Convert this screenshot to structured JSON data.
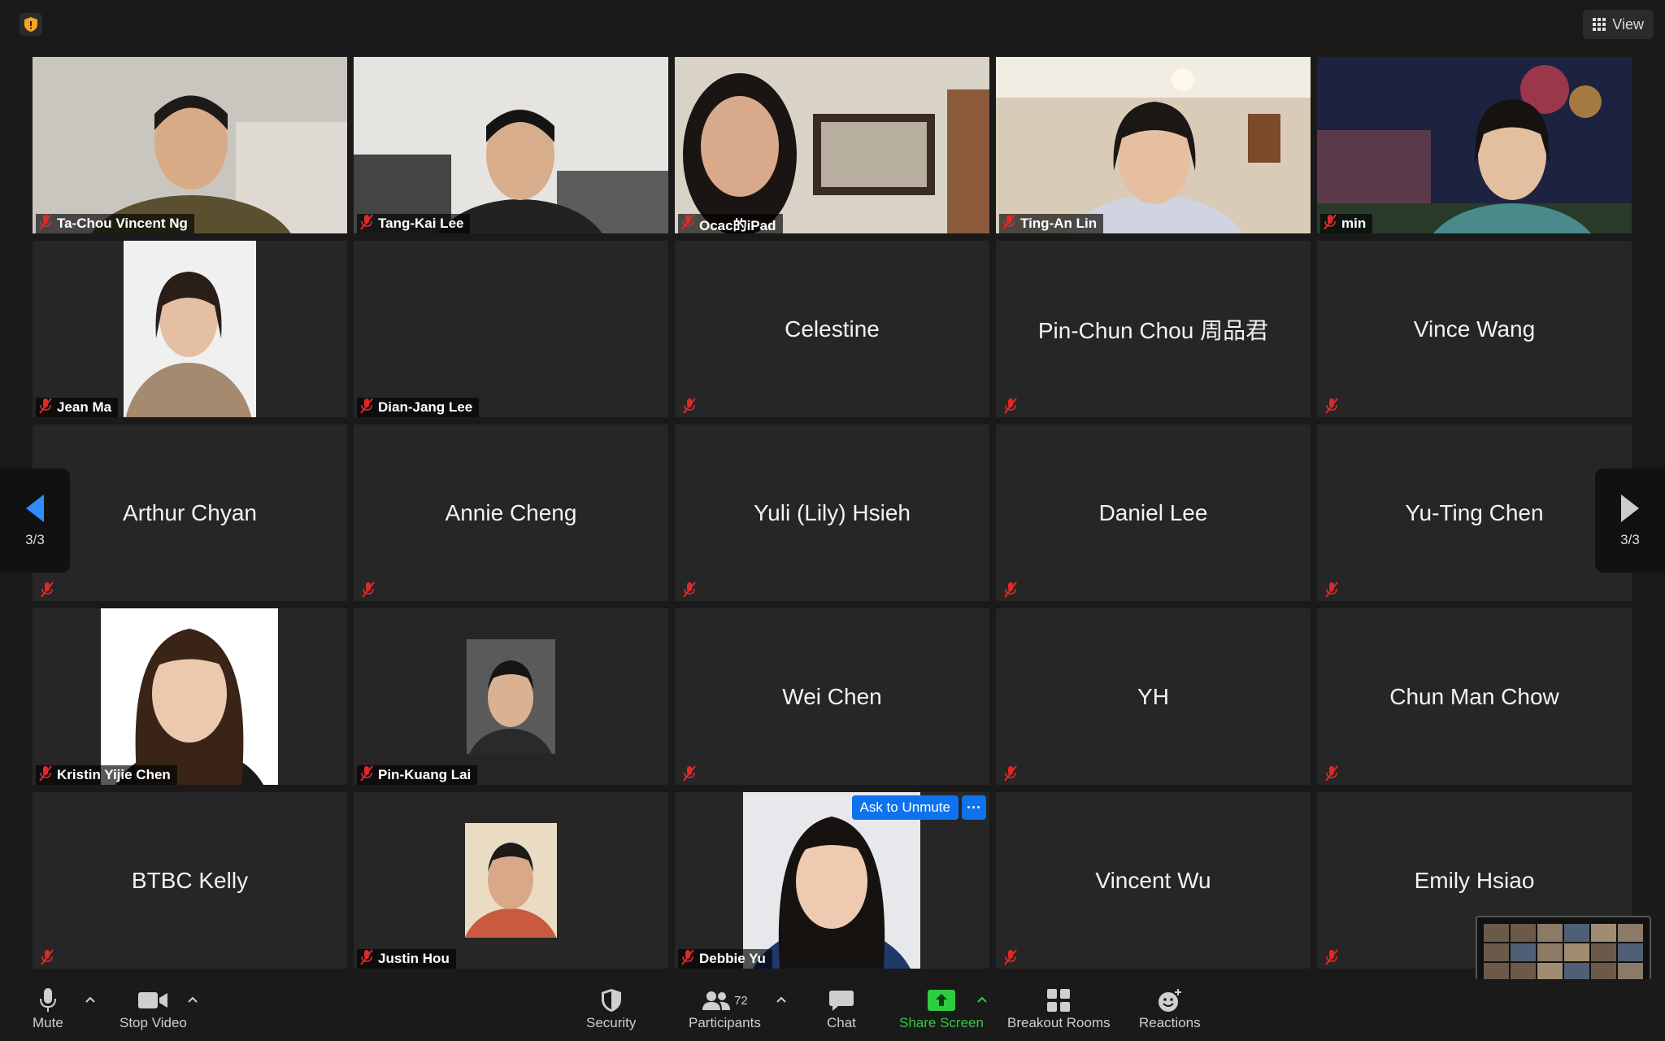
{
  "topbar": {
    "view_label": "View"
  },
  "pagination": {
    "left_label": "3/3",
    "right_label": "3/3"
  },
  "tiles": [
    {
      "name": "Ta-Chou Vincent Ng",
      "mode": "video"
    },
    {
      "name": "Tang-Kai Lee",
      "mode": "video"
    },
    {
      "name": "Ocac的iPad",
      "mode": "video"
    },
    {
      "name": "Ting-An Lin",
      "mode": "video"
    },
    {
      "name": "min",
      "mode": "video"
    },
    {
      "name": "Jean Ma",
      "mode": "photo"
    },
    {
      "name": "Dian-Jang Lee",
      "mode": "blank"
    },
    {
      "name": "Celestine",
      "mode": "name"
    },
    {
      "name": "Pin-Chun Chou 周品君",
      "mode": "name"
    },
    {
      "name": "Vince Wang",
      "mode": "name"
    },
    {
      "name": "Arthur Chyan",
      "mode": "name"
    },
    {
      "name": "Annie Cheng",
      "mode": "name"
    },
    {
      "name": "Yuli (Lily) Hsieh",
      "mode": "name"
    },
    {
      "name": "Daniel Lee",
      "mode": "name"
    },
    {
      "name": "Yu-Ting Chen",
      "mode": "name"
    },
    {
      "name": "Kristin Yijie Chen",
      "mode": "photo"
    },
    {
      "name": "Pin-Kuang Lai",
      "mode": "photo"
    },
    {
      "name": "Wei Chen",
      "mode": "name"
    },
    {
      "name": "YH",
      "mode": "name"
    },
    {
      "name": "Chun Man Chow",
      "mode": "name"
    },
    {
      "name": "BTBC Kelly",
      "mode": "name"
    },
    {
      "name": "Justin Hou",
      "mode": "photo"
    },
    {
      "name": "Debbie Yu",
      "mode": "photo"
    },
    {
      "name": "Vincent Wu",
      "mode": "name"
    },
    {
      "name": "Emily Hsiao",
      "mode": "name"
    }
  ],
  "spotlight_tile": {
    "ask_unmute_label": "Ask to Unmute",
    "more_label": "···"
  },
  "toolbar": {
    "mute_label": "Mute",
    "stop_video_label": "Stop Video",
    "security_label": "Security",
    "participants_label": "Participants",
    "participants_count": "72",
    "chat_label": "Chat",
    "share_screen_label": "Share Screen",
    "breakout_label": "Breakout Rooms",
    "reactions_label": "Reactions"
  },
  "colors": {
    "accent": "#0e72ed",
    "share_green": "#2ecc40",
    "muted_red": "#e02828",
    "tile_bg": "#262626"
  }
}
